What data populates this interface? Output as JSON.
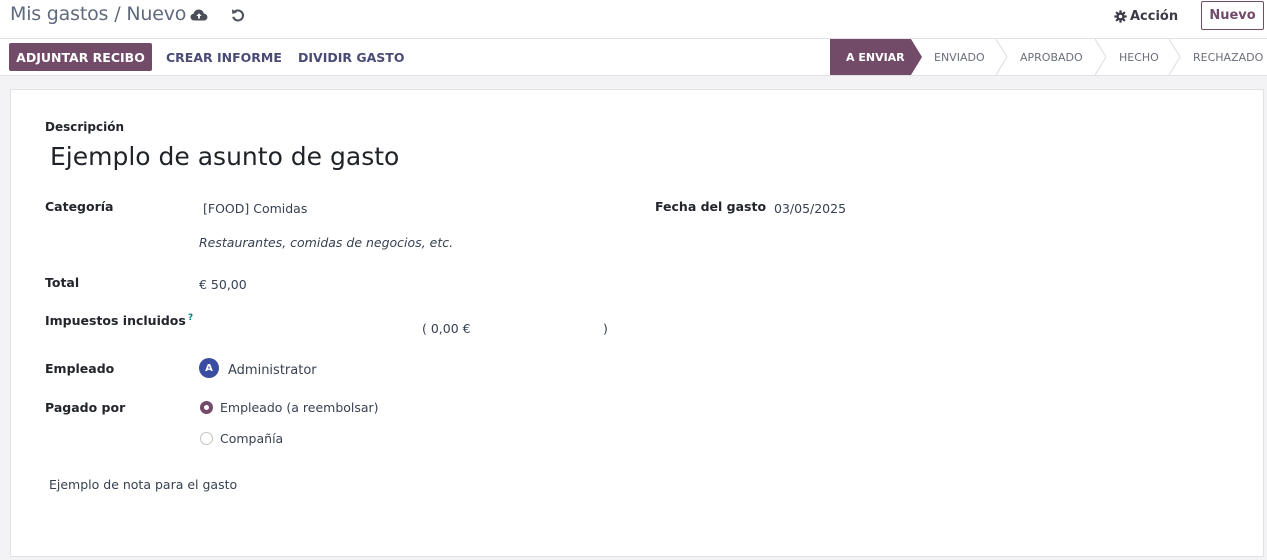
{
  "breadcrumb": {
    "parent": "Mis gastos",
    "separator": "/",
    "current": "Nuevo"
  },
  "topbar": {
    "action_label": "Acción",
    "new_label": "Nuevo"
  },
  "buttons": {
    "attach_receipt": "ADJUNTAR RECIBO",
    "create_report": "CREAR INFORME",
    "split_expense": "DIVIDIR GASTO"
  },
  "stages": {
    "to_send": "A ENVIAR",
    "sent": "ENVIADO",
    "approved": "APROBADO",
    "done": "HECHO",
    "refused": "RECHAZADO",
    "active": "to_send"
  },
  "form": {
    "description_label": "Descripción",
    "description_value": "Ejemplo de asunto de gasto",
    "category_label": "Categoría",
    "category_value": "[FOOD] Comidas",
    "category_hint": "Restaurantes, comidas de negocios, etc.",
    "date_label": "Fecha del gasto",
    "date_value": "03/05/2025",
    "total_label": "Total",
    "total_value": "€ 50,00",
    "taxes_label": "Impuestos incluidos",
    "taxes_help": "?",
    "taxes_open": "( 0,00 €",
    "taxes_close": ")",
    "employee_label": "Empleado",
    "employee_initial": "A",
    "employee_value": "Administrator",
    "paid_by_label": "Pagado por",
    "paid_by_options": [
      "Empleado (a reembolsar)",
      "Compañía"
    ],
    "paid_by_selected": 0,
    "note": "Ejemplo de nota para el gasto"
  },
  "colors": {
    "brand": "#714b67",
    "link": "#4a4b75",
    "avatar": "#3b4da0"
  },
  "icons": [
    "cloud-upload-icon",
    "undo-icon",
    "gear-icon"
  ]
}
